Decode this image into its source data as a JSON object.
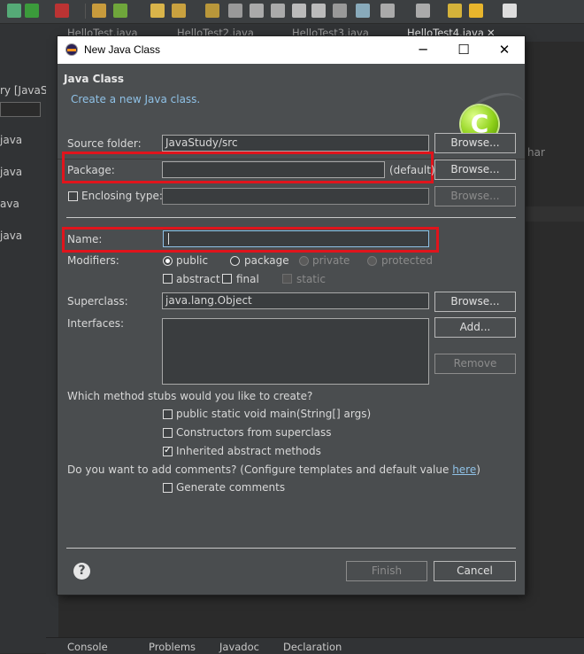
{
  "editor": {
    "tabs": [
      "HelloTest.java",
      "HelloTest2.java",
      "HelloTest3.java",
      "HelloTest4.java"
    ],
    "active_tab_close": "✕",
    "left_panel": [
      "ry [JavaS",
      "java",
      "java",
      "ava",
      "java"
    ],
    "code_fragment": "har",
    "bottom_tabs": [
      "Console",
      "Problems",
      "Javadoc",
      "Declaration"
    ]
  },
  "dialog": {
    "title": "New Java Class",
    "min": "─",
    "max": "☐",
    "close": "✕",
    "banner_title": "Java Class",
    "banner_message": "Create a new Java class.",
    "banner_icon_letter": "C",
    "source_folder_label": "Source folder:",
    "source_folder_value": "JavaStudy/src",
    "package_label": "Package:",
    "package_value": "",
    "package_default": "(default)",
    "enclosing_label": "Enclosing type:",
    "enclosing_value": "",
    "name_label": "Name:",
    "name_value": "",
    "modifiers_label": "Modifiers:",
    "mod_public": "public",
    "mod_package": "package",
    "mod_private": "private",
    "mod_protected": "protected",
    "mod_abstract": "abstract",
    "mod_final": "final",
    "mod_static": "static",
    "superclass_label": "Superclass:",
    "superclass_value": "java.lang.Object",
    "interfaces_label": "Interfaces:",
    "browse": "Browse...",
    "add": "Add...",
    "remove": "Remove",
    "stubs_question": "Which method stubs would you like to create?",
    "stub_main": "public static void main(String[] args)",
    "stub_constructors": "Constructors from superclass",
    "stub_inherited": "Inherited abstract methods",
    "comments_question": "Do you want to add comments? (Configure templates and default value ",
    "comments_link": "here",
    "comments_close": ")",
    "generate_comments": "Generate comments",
    "help": "?",
    "finish": "Finish",
    "cancel": "Cancel"
  }
}
